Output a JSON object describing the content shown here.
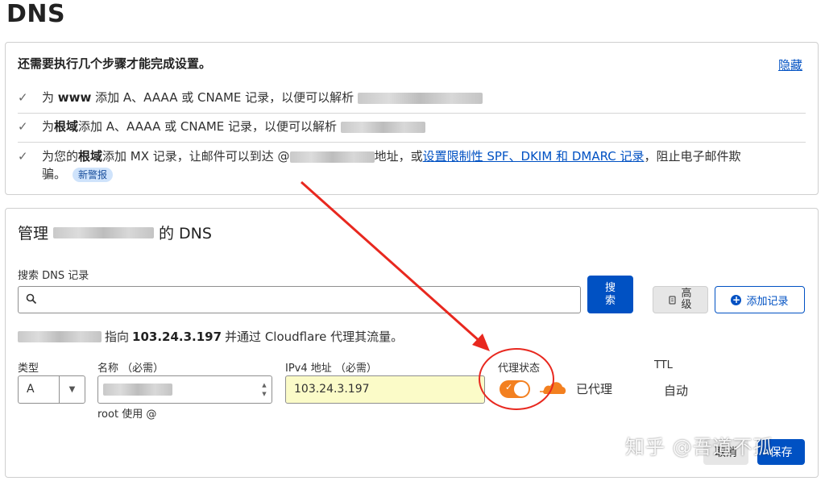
{
  "page": {
    "title": "DNS"
  },
  "setup": {
    "title": "还需要执行几个步骤才能完成设置。",
    "hide_label": "隐藏",
    "steps": [
      {
        "prefix": "为 ",
        "bold": "www",
        "suffix": " 添加 A、AAAA 或 CNAME 记录，以便可以解析"
      },
      {
        "prefix": "为",
        "bold": "根域",
        "suffix": "添加 A、AAAA 或 CNAME 记录，以便可以解析"
      },
      {
        "prefix": "为您的",
        "bold": "根域",
        "suffix": "添加 MX 记录，让邮件可以到达 @",
        "mid": "地址，或",
        "link": "设置限制性 SPF、DKIM 和 DMARC 记录",
        "tail": "，阻止电子邮件欺",
        "tail2": "骗。",
        "badge": "新警报"
      }
    ]
  },
  "dns": {
    "manage_prefix": "管理",
    "manage_suffix": "的 DNS",
    "search_label": "搜索 DNS 记录",
    "search_value": "",
    "search_button": "搜\n索",
    "advanced_button": "高\n级",
    "add_record_button": "添加记录",
    "info_mid": "指向",
    "info_ip": "103.24.3.197",
    "info_tail": "并通过 Cloudflare 代理其流量。"
  },
  "form": {
    "type_label": "类型",
    "type_value": "A",
    "name_label": "名称 （必需）",
    "name_hint": "root 使用 @",
    "ip_label": "IPv4 地址 （必需）",
    "ip_value": "103.24.3.197",
    "proxy_label": "代理状态",
    "proxy_status": "已代理",
    "ttl_label": "TTL",
    "ttl_value": "自动",
    "cancel_button": "取消",
    "save_button": "保存"
  },
  "colors": {
    "accent": "#0051c3",
    "proxy_orange": "#f38020",
    "annotation_red": "#e8281f",
    "ip_field_bg": "#fbfbc8"
  },
  "watermark": "知乎 @吾道不孤"
}
